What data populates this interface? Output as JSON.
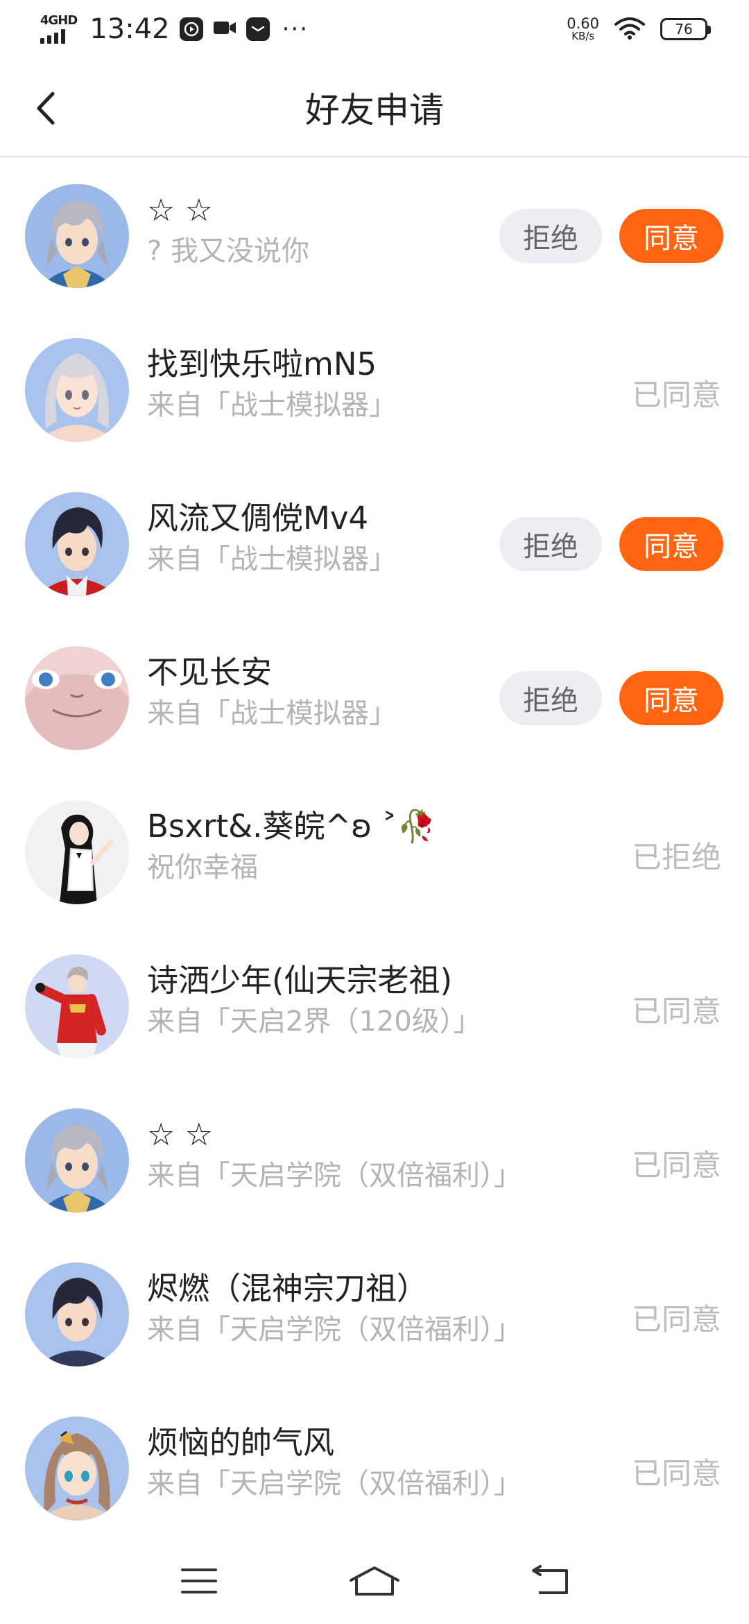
{
  "status_bar": {
    "network": "4GHD",
    "time": "13:42",
    "speed_value": "0.60",
    "speed_unit": "KB/s",
    "battery": "76",
    "icons": [
      "play-icon",
      "video-icon",
      "message-icon",
      "more-dots-icon",
      "wifi-icon",
      "battery-icon"
    ]
  },
  "header": {
    "title": "好友申请",
    "back_icon": "chevron-left-icon"
  },
  "actions": {
    "reject": "拒绝",
    "accept": "同意"
  },
  "requests": [
    {
      "name": "☆ ☆",
      "subtitle": "? 我又没说你",
      "status": "",
      "pending": true,
      "avatar": "silver-haired-boy-avatar"
    },
    {
      "name": "找到快乐啦mN5",
      "subtitle": "来自「战士模拟器」",
      "status": "已同意",
      "pending": false,
      "avatar": "silver-haired-girl-avatar"
    },
    {
      "name": "风流又倜傥Mv4",
      "subtitle": "来自「战士模拟器」",
      "status": "",
      "pending": true,
      "avatar": "dark-haired-boy-red-avatar"
    },
    {
      "name": "不见长安",
      "subtitle": "来自「战士模拟器」",
      "status": "",
      "pending": true,
      "avatar": "pink-cat-avatar"
    },
    {
      "name": "Bsxrt&.葵皖^ʚ ˃🥀",
      "subtitle": "祝你幸福",
      "status": "已拒绝",
      "pending": false,
      "avatar": "black-haired-girl-avatar"
    },
    {
      "name": "诗洒少年(仙天宗老祖)",
      "subtitle": "来自「天启2界（120级）」",
      "status": "已同意",
      "pending": false,
      "avatar": "red-uniform-character-avatar"
    },
    {
      "name": "☆ ☆",
      "subtitle": "来自「天启学院（双倍福利）」",
      "status": "已同意",
      "pending": false,
      "avatar": "silver-haired-boy-avatar"
    },
    {
      "name": "烬燃（混神宗刀祖）",
      "subtitle": "来自「天启学院（双倍福利）」",
      "status": "已同意",
      "pending": false,
      "avatar": "dark-haired-boy-avatar"
    },
    {
      "name": "烦恼的帥气风",
      "subtitle": "来自「天启学院（双倍福利）」",
      "status": "已同意",
      "pending": false,
      "avatar": "brown-haired-girl-avatar"
    }
  ],
  "nav_bar": {
    "items": [
      "menu-icon",
      "home-icon",
      "back-icon"
    ]
  },
  "colors": {
    "accent": "#ff6410",
    "reject_bg": "#eceef3",
    "muted_text": "#b4b4b4"
  }
}
